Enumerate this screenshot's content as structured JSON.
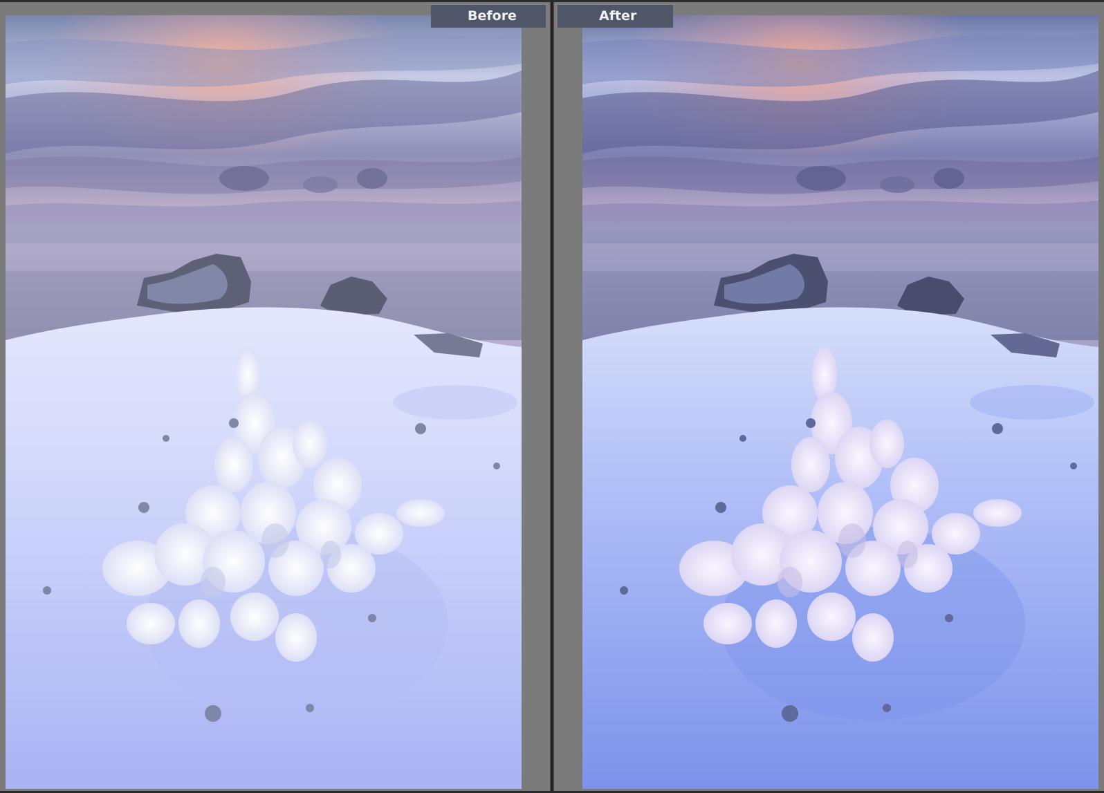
{
  "compare": {
    "before_label": "Before",
    "after_label": "After"
  },
  "photos": {
    "before": {
      "sky_top": "#6f7aa5",
      "sky_mid": "#b9b3d6",
      "glow": "#f3a98e",
      "haze": "#c8bfd9",
      "sea": "#a9a4c4",
      "snow": "#d7dcfb",
      "snow_shadow": "#a8b0f2",
      "rock": "#5d6076",
      "ice": "#f1f0fb"
    },
    "after": {
      "sky_top": "#5f6ba0",
      "sky_mid": "#a9a7d6",
      "glow": "#f6a88c",
      "haze": "#bdb6da",
      "sea": "#9a9ac0",
      "snow": "#bcc8fb",
      "snow_shadow": "#6f86e6",
      "rock": "#4c5171",
      "ice": "#f4eefc"
    }
  }
}
